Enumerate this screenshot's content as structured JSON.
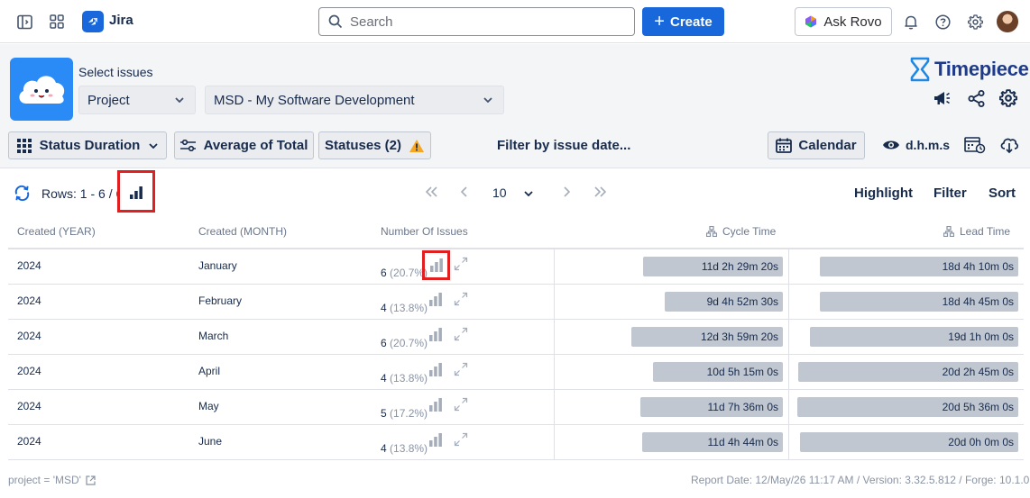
{
  "topnav": {
    "app_name": "Jira",
    "search_placeholder": "Search",
    "create_label": "Create",
    "ask_rovo_label": "Ask Rovo"
  },
  "header": {
    "select_issues_label": "Select issues",
    "scope_select_value": "Project",
    "project_select_value": "MSD - My Software Development",
    "brand_name": "Timepiece"
  },
  "toolbar": {
    "status_duration_label": "Status Duration",
    "average_label": "Average of Total",
    "statuses_label": "Statuses (2)",
    "filter_by_date_label": "Filter by issue date...",
    "calendar_label": "Calendar",
    "time_format_label": "d.h.m.s"
  },
  "rows_bar": {
    "rows_label": "Rows: 1 - 6 / 6",
    "page_size": "10",
    "highlight_label": "Highlight",
    "filter_label": "Filter",
    "sort_label": "Sort"
  },
  "table": {
    "headers": {
      "created_year": "Created (YEAR)",
      "created_month": "Created (MONTH)",
      "number_of_issues": "Number Of Issues",
      "cycle_time": "Cycle Time",
      "lead_time": "Lead Time"
    },
    "rows": [
      {
        "year": "2024",
        "month": "January",
        "count": "6",
        "pct": "(20.7%)",
        "cycle": "11d 2h 29m 20s",
        "cycle_days": 11.1,
        "lead": "18d 4h 10m 0s",
        "lead_days": 18.17
      },
      {
        "year": "2024",
        "month": "February",
        "count": "4",
        "pct": "(13.8%)",
        "cycle": "9d 4h 52m 30s",
        "cycle_days": 9.2,
        "lead": "18d 4h 45m 0s",
        "lead_days": 18.2
      },
      {
        "year": "2024",
        "month": "March",
        "count": "6",
        "pct": "(20.7%)",
        "cycle": "12d 3h 59m 20s",
        "cycle_days": 12.17,
        "lead": "19d 1h 0m 0s",
        "lead_days": 19.04
      },
      {
        "year": "2024",
        "month": "April",
        "count": "4",
        "pct": "(13.8%)",
        "cycle": "10d 5h 15m 0s",
        "cycle_days": 10.22,
        "lead": "20d 2h 45m 0s",
        "lead_days": 20.11
      },
      {
        "year": "2024",
        "month": "May",
        "count": "5",
        "pct": "(17.2%)",
        "cycle": "11d 7h 36m 0s",
        "cycle_days": 11.32,
        "lead": "20d 5h 36m 0s",
        "lead_days": 20.23
      },
      {
        "year": "2024",
        "month": "June",
        "count": "4",
        "pct": "(13.8%)",
        "cycle": "11d 4h 44m 0s",
        "cycle_days": 11.2,
        "lead": "20d 0h 0m 0s",
        "lead_days": 20.0
      }
    ]
  },
  "footer": {
    "query": "project = 'MSD'",
    "report_info": "Report Date: 12/May/26 11:17 AM / Version: 3.32.5.812 / Forge: 10.1.0"
  },
  "colors": {
    "accent": "#1868db",
    "highlight_border": "#e02020",
    "bar_fill": "#c1c7d0",
    "warning": "#f5a623"
  }
}
